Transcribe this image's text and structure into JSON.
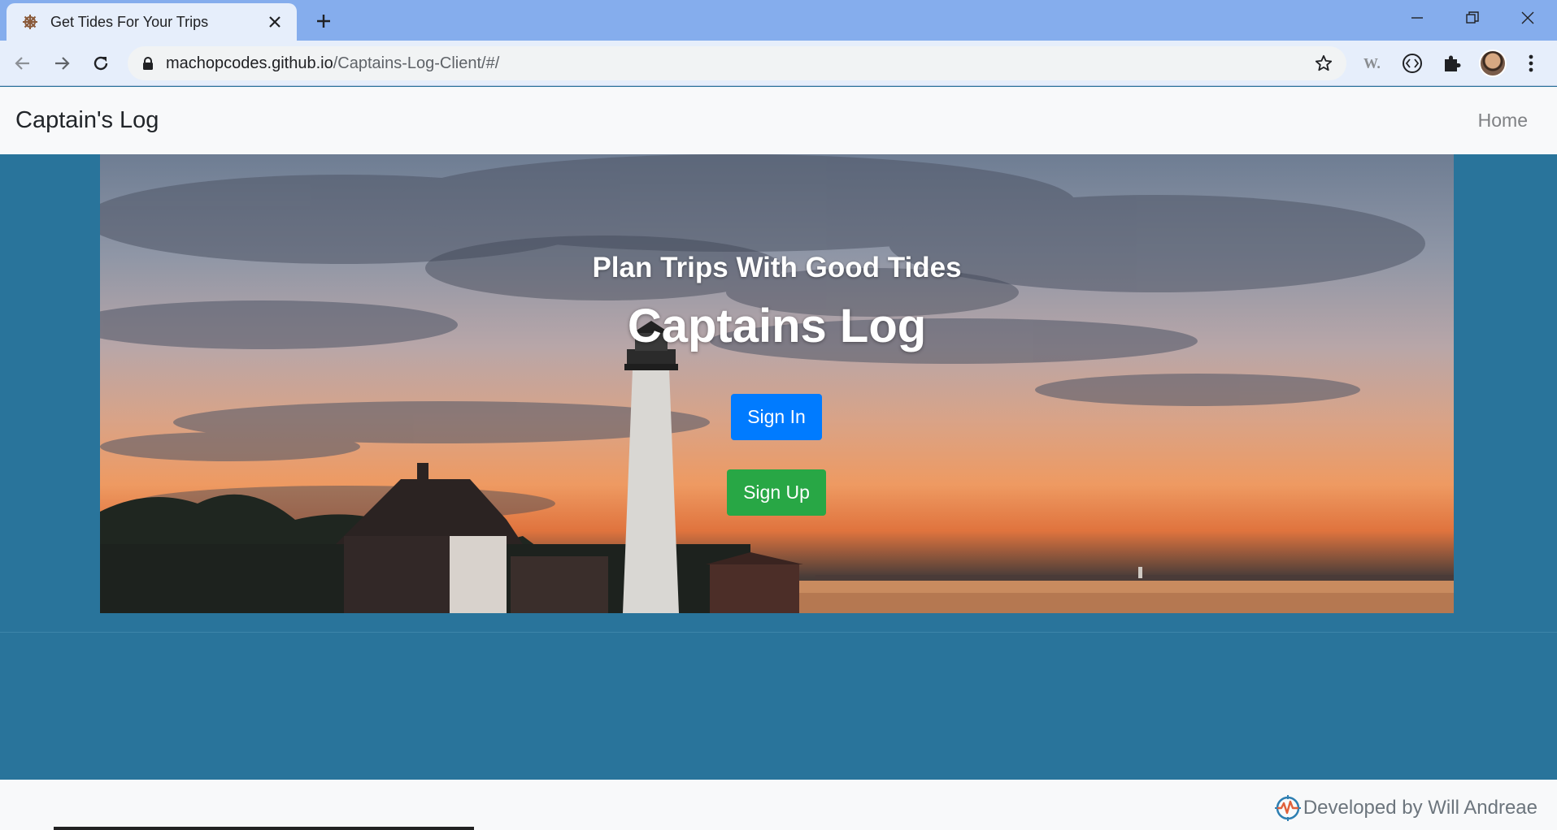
{
  "browser": {
    "tab_title": "Get Tides For Your Trips",
    "url_host": "machopcodes.github.io",
    "url_path": "/Captains-Log-Client/#/",
    "icons": [
      "settings-wheel-icon",
      "close-icon",
      "plus-icon",
      "minimize-icon",
      "restore-icon",
      "close-window-icon",
      "back-icon",
      "forward-icon",
      "reload-icon",
      "lock-icon",
      "star-icon",
      "w-extension-icon",
      "code-extension-icon",
      "puzzle-icon",
      "kebab-menu-icon"
    ]
  },
  "site": {
    "brand": "Captain's Log",
    "nav_home": "Home"
  },
  "hero": {
    "subtitle": "Plan Trips With Good Tides",
    "title": "Captains Log",
    "signin_label": "Sign In",
    "signup_label": "Sign Up"
  },
  "footer": {
    "credit": "Developed by Will Andreae"
  },
  "colors": {
    "page_bg": "#29749b",
    "signin": "#007bff",
    "signup": "#28a745",
    "nav_bg": "#f8f9fa"
  }
}
